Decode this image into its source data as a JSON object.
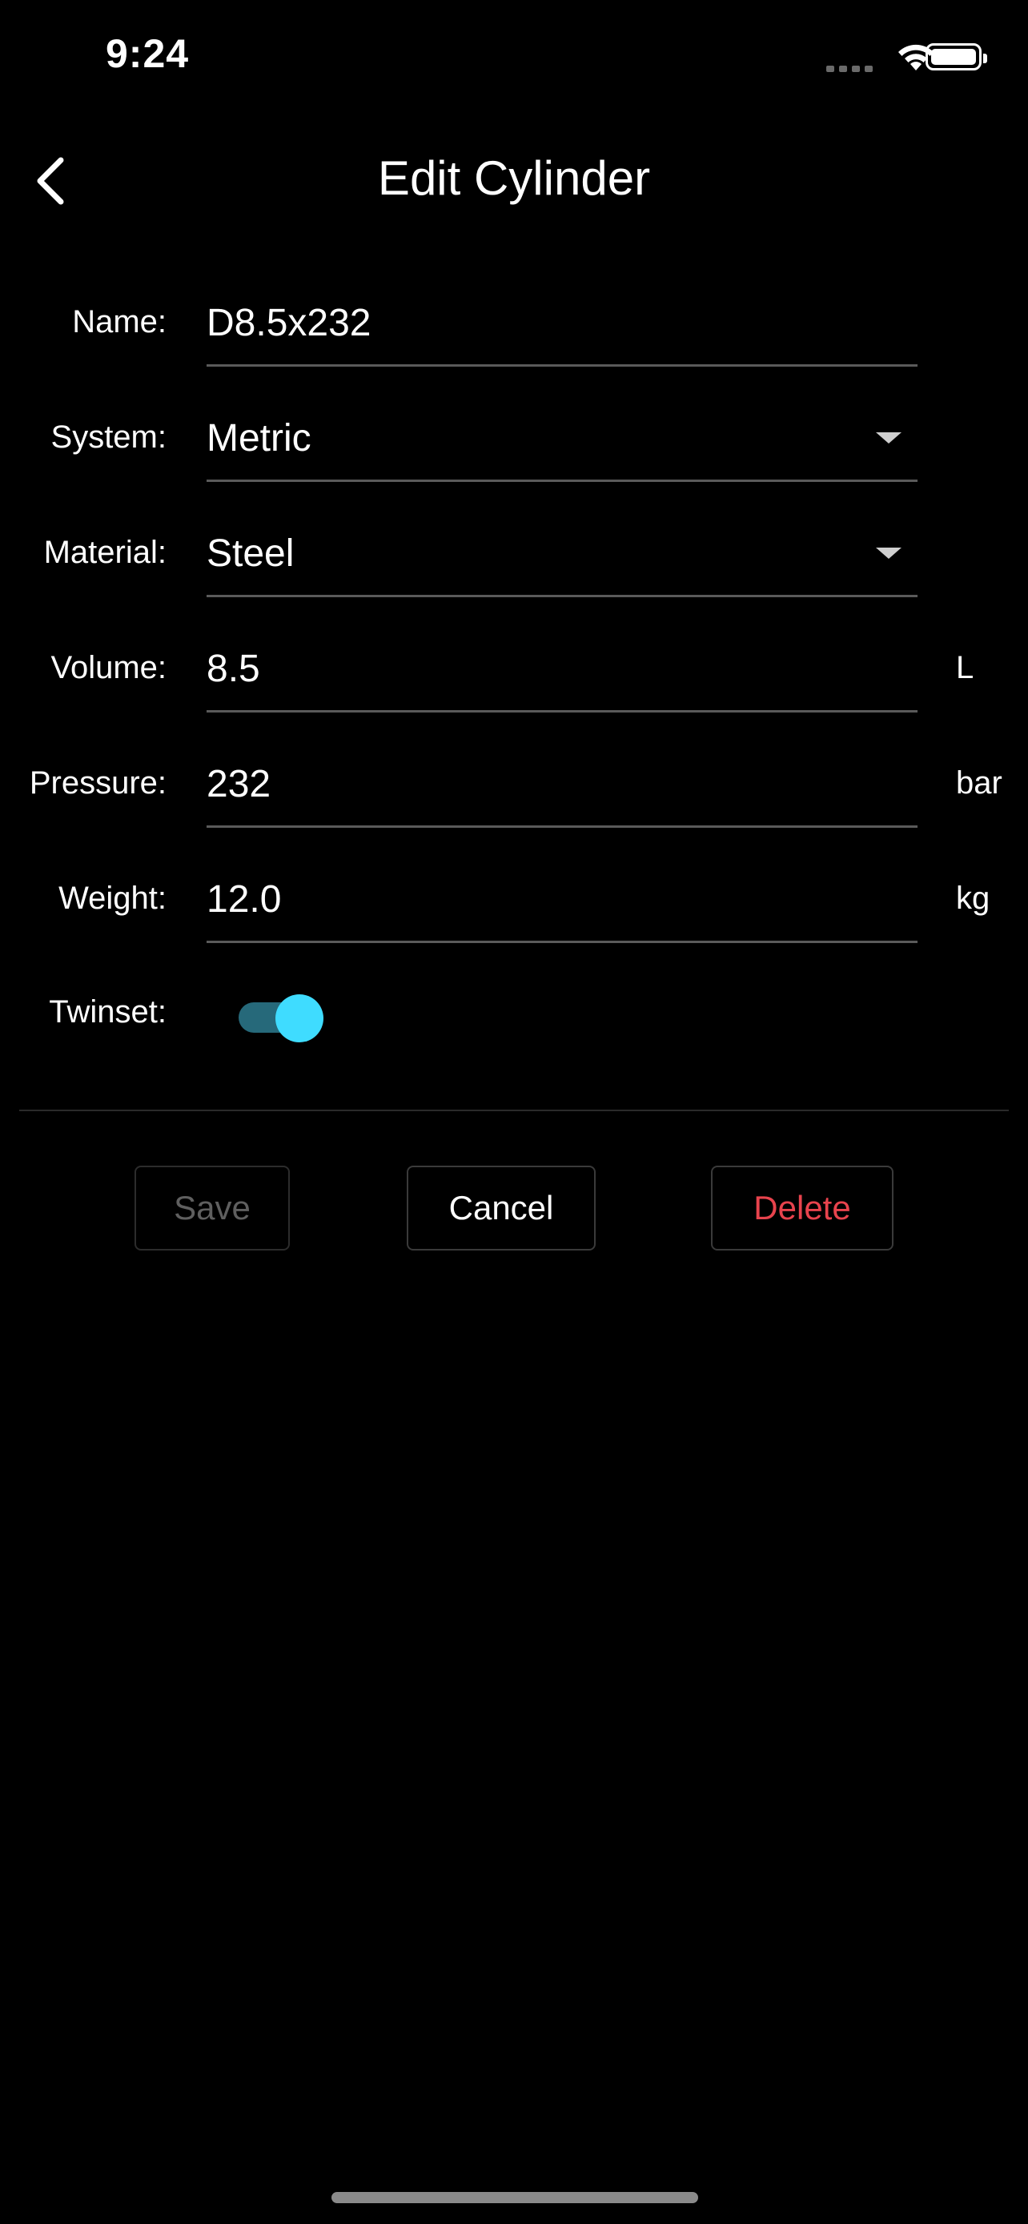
{
  "status_bar": {
    "time": "9:24",
    "signal_icon": "cellular-signal-icon",
    "wifi_icon": "wifi-icon",
    "battery_icon": "battery-icon"
  },
  "header": {
    "title": "Edit Cylinder",
    "back_icon": "chevron-left-icon"
  },
  "form": {
    "name": {
      "label": "Name:",
      "value": "D8.5x232"
    },
    "system": {
      "label": "System:",
      "value": "Metric"
    },
    "material": {
      "label": "Material:",
      "value": "Steel"
    },
    "volume": {
      "label": "Volume:",
      "value": "8.5",
      "unit": "L"
    },
    "pressure": {
      "label": "Pressure:",
      "value": "232",
      "unit": "bar"
    },
    "weight": {
      "label": "Weight:",
      "value": "12.0",
      "unit": "kg"
    },
    "twinset": {
      "label": "Twinset:",
      "on": true
    }
  },
  "actions": {
    "save_label": "Save",
    "cancel_label": "Cancel",
    "delete_label": "Delete"
  },
  "colors": {
    "background": "#000000",
    "toggle_accent": "#3fdcff",
    "delete_text": "#e8434d",
    "disabled_text": "#5f5f5f"
  }
}
